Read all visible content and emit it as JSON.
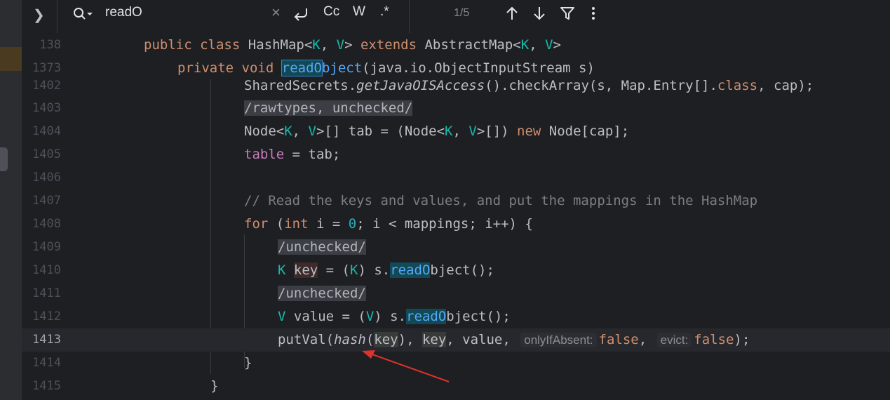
{
  "find_bar": {
    "query": "readO",
    "clear_icon": "×",
    "regex_label": ".*",
    "case_label": "Cc",
    "words_label": "W",
    "match_count": "1/5"
  },
  "sticky": {
    "lines": [
      {
        "num": "138",
        "parts": [
          "public",
          "class",
          "HashMap<",
          "K",
          ", ",
          "V",
          "> ",
          "extends",
          " AbstractMap<",
          "K",
          ", ",
          "V",
          ">"
        ]
      },
      {
        "num": "1373",
        "parts": [
          "private",
          "void",
          "readO",
          "bject",
          "(java.io.ObjectInputStream s)"
        ]
      }
    ]
  },
  "lines": [
    {
      "num": "1402",
      "text": [
        "SharedSecrets.",
        "getJavaOISAccess",
        "().checkArray(s, Map.Entry[].",
        "class",
        ", cap);"
      ]
    },
    {
      "num": "1403",
      "text": [
        "/rawtypes, unchecked/"
      ]
    },
    {
      "num": "1404",
      "text": [
        "Node<",
        "K",
        ", ",
        "V",
        ">[] tab = (Node<",
        "K",
        ", ",
        "V",
        ">[]) ",
        "new",
        " Node[cap];"
      ]
    },
    {
      "num": "1405",
      "text": [
        "table",
        " = tab;"
      ]
    },
    {
      "num": "1406",
      "text": [
        ""
      ]
    },
    {
      "num": "1407",
      "text": [
        "// Read the keys and values, and put the mappings in the HashMap"
      ]
    },
    {
      "num": "1408",
      "text": [
        "for",
        " (",
        "int",
        " i = ",
        "0",
        "; i < mappings; i++) {"
      ]
    },
    {
      "num": "1409",
      "text": [
        "/unchecked/"
      ]
    },
    {
      "num": "1410",
      "text": [
        "K",
        " ",
        "key",
        " = (",
        "K",
        ") s.",
        "readO",
        "bject();"
      ]
    },
    {
      "num": "1411",
      "text": [
        "/unchecked/"
      ]
    },
    {
      "num": "1412",
      "text": [
        "V",
        " value = (",
        "V",
        ") s.",
        "readO",
        "bject();"
      ]
    },
    {
      "num": "1413",
      "text": [
        "putVal(",
        "hash",
        "(",
        "key",
        "), ",
        "key",
        ", value, ",
        "onlyIfAbsent:",
        "false",
        ", ",
        "evict:",
        "false",
        ");"
      ]
    },
    {
      "num": "1414",
      "text": [
        "}"
      ]
    },
    {
      "num": "1415",
      "text": [
        "}"
      ]
    }
  ],
  "annotation": {
    "arrow_color": "#e0322d"
  }
}
